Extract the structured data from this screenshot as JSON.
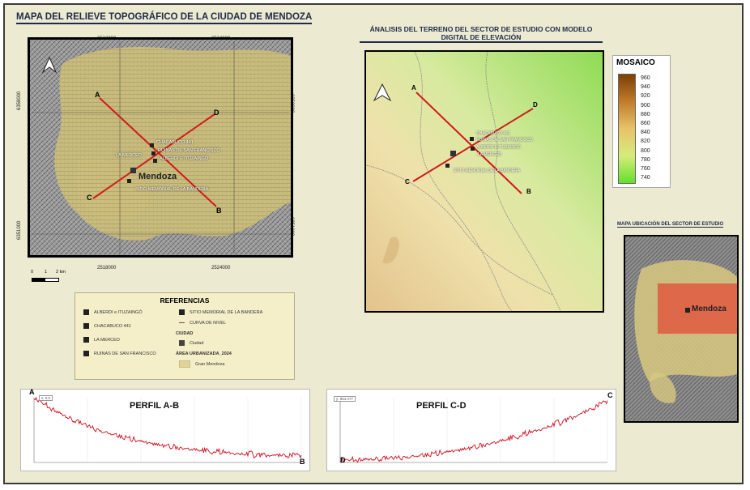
{
  "map_main": {
    "title": "MAPA DEL RELIEVE TOPOGRÁFICO DE LA CIUDAD DE MENDOZA",
    "coords_top": [
      "2518000",
      "2524000"
    ],
    "coords_bottom": [
      "2518000",
      "2524000"
    ],
    "coords_left": [
      "6358000",
      "6351000"
    ],
    "coords_right": [
      "6358000",
      "6351000"
    ],
    "city_label": "Mendoza",
    "point_labels": {
      "a": "A",
      "b": "B",
      "c": "C",
      "d": "D",
      "chacabuco": "CHACABUCO 441",
      "ruinas": "RUINAS DE SAN FRANCISCO",
      "alberdi": "ALBERDI E ITUZAINGÓ",
      "merced": "LA MERCED",
      "sitio": "SITIO MEMORIAL DE LA BANDERA"
    },
    "scale": [
      "0",
      "1",
      "2 km"
    ]
  },
  "legend": {
    "title": "REFERENCIAS",
    "items": [
      "ALBERDI e ITUZAINGÓ",
      "CHACABUCO 441",
      "LA MERCED",
      "RUINAS DE SAN FRANCISCO"
    ],
    "items2": [
      "SITIO MEMORIAL DE LA BANDERA",
      "CURVA DE NIVEL"
    ],
    "ciudad_header": "CIUDAD",
    "ciudad_item": "Ciudad",
    "area_header": "ÁREA URBANIZADA_2024",
    "area_item": "Gran Mendoza"
  },
  "dem_map": {
    "title_line1": "ÁNALISIS DEL TERRENO DEL SECTOR DE ESTUDIO CON MODELO",
    "title_line2": "DIGITAL DE ELEVACIÓN",
    "point_labels": {
      "a": "A",
      "b": "B",
      "c": "C",
      "d": "D",
      "chacabuco": "CHACABUCO 441",
      "ruinas": "RUINAS DE SAN FRANCISCO",
      "alberdi": "ALBERDI E ITUZAINGÓ",
      "merced": "LA MERCED",
      "sitio": "SITIO MEMORIAL DE LA BANDERA"
    }
  },
  "mosaico": {
    "title": "MOSAICO",
    "values": [
      "960",
      "940",
      "920",
      "900",
      "880",
      "860",
      "840",
      "820",
      "800",
      "780",
      "760",
      "740"
    ]
  },
  "location_map": {
    "title": "MAPA UBICACIÓN DEL SECTOR DE ESTUDIO",
    "city_label": "Mendoza"
  },
  "profile_ab": {
    "title": "PERFIL A-B",
    "start": "A",
    "end": "B",
    "readout": "x: 0.0",
    "line_color": "#cc0f1e"
  },
  "profile_cd": {
    "title": "PERFIL C-D",
    "start": "D",
    "end": "C",
    "readout": "y: 964.477",
    "line_color": "#cc0f1e"
  },
  "colors": {
    "profile_line": "#cc0f1e",
    "urban_area": "#d9c777",
    "dem_high": "#8b4a0d",
    "dem_low": "#7fe030",
    "study_area": "#e2503b"
  }
}
